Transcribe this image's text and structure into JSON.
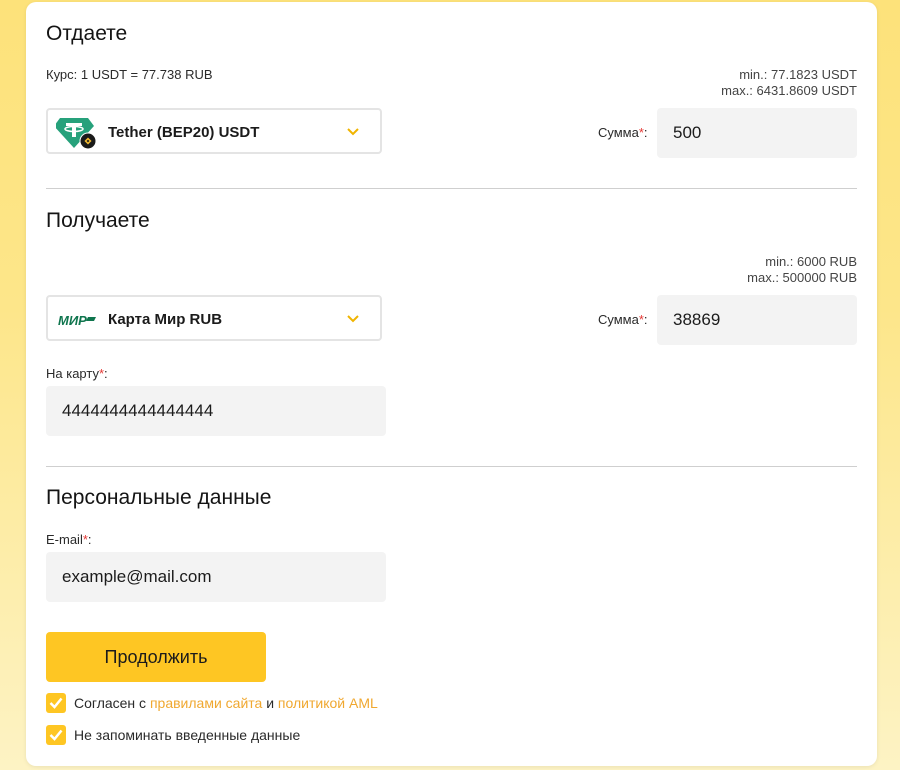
{
  "give": {
    "title": "Отдаете",
    "rate": "Курс: 1 USDT = 77.738 RUB",
    "min": "min.: 77.1823 USDT",
    "max": "max.: 6431.8609 USDT",
    "currency_label": "Tether (BEP20) USDT",
    "currency_icon": "tether-bep20-icon",
    "amount_label": "Сумма",
    "amount_value": "500"
  },
  "receive": {
    "title": "Получаете",
    "min": "min.: 6000 RUB",
    "max": "max.: 500000 RUB",
    "currency_label": "Карта Мир RUB",
    "currency_icon": "mir-logo-icon",
    "amount_label": "Сумма",
    "amount_value": "38869",
    "card_label": "На карту",
    "card_value": "4444444444444444"
  },
  "personal": {
    "title": "Персональные данные",
    "email_label": "E-mail",
    "email_placeholder": "example@mail.com"
  },
  "required_mark": "*",
  "colon": ":",
  "submit_label": "Продолжить",
  "agree": {
    "prefix": "Согласен с",
    "link_rules": "правилами сайта",
    "and": "и",
    "link_aml": "политикой AML",
    "checked": true
  },
  "no_remember": {
    "label": "Не запоминать введенные данные",
    "checked": true
  },
  "colors": {
    "accent": "#fec623",
    "link": "#f0a830",
    "required": "#e53935",
    "tether": "#26a17b",
    "mir": "#0f754e"
  }
}
